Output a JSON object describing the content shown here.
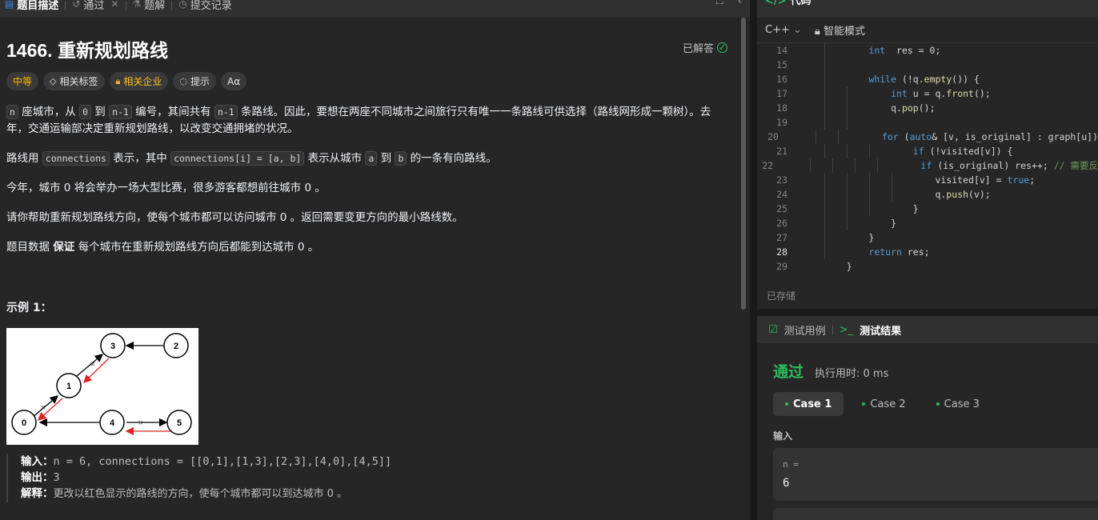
{
  "tabs": [
    {
      "label": "题目描述",
      "icon": "document-icon"
    },
    {
      "label": "通过",
      "icon": "history-icon"
    },
    {
      "label": "题解",
      "icon": "flask-icon"
    },
    {
      "label": "提交记录",
      "icon": "clock-icon"
    }
  ],
  "problem": {
    "title": "1466. 重新规划路线",
    "solved_label": "已解答",
    "tags": {
      "difficulty": "中等",
      "related_tags": "相关标签",
      "companies": "相关企业",
      "hint": "提示",
      "font": "Aα"
    },
    "desc": {
      "p1_code_n": "n",
      "p1_a": " 座城市，从 ",
      "p1_code_0": "0",
      "p1_b": " 到 ",
      "p1_code_n1": "n-1",
      "p1_c": " 编号，其间共有 ",
      "p1_code_n1b": "n-1",
      "p1_d": " 条路线。因此，要想在两座不同城市之间旅行只有唯一一条路线可供选择（路线网形成一颗树）。去年，交通运输部决定重新规划路线，以改变交通拥堵的状况。",
      "p2_a": "路线用 ",
      "p2_code1": "connections",
      "p2_b": " 表示，其中 ",
      "p2_code2": "connections[i] = [a, b]",
      "p2_c": " 表示从城市 ",
      "p2_code3": "a",
      "p2_d": " 到 ",
      "p2_code4": "b",
      "p2_e": " 的一条有向路线。",
      "p3": "今年，城市 0 将会举办一场大型比赛，很多游客都想前往城市 0 。",
      "p4": "请你帮助重新规划路线方向，使每个城市都可以访问城市 0 。返回需要变更方向的最小路线数。",
      "p5_a": "题目数据 ",
      "p5_bold": "保证",
      "p5_b": " 每个城市在重新规划路线方向后都能到达城市 0 。"
    },
    "example": {
      "title": "示例 1：",
      "graph_nodes": [
        "0",
        "1",
        "3",
        "2",
        "4",
        "5"
      ],
      "graph_mark": "×",
      "input_label": "输入：",
      "input_value": "n = 6, connections = [[0,1],[1,3],[2,3],[4,0],[4,5]]",
      "output_label": "输出：",
      "output_value": "3",
      "explain_label": "解释：",
      "explain_value": "更改以红色显示的路线的方向，使每个城市都可以到达城市 0 。"
    }
  },
  "editor": {
    "title": "代码",
    "language": "C++",
    "mode": "智能模式",
    "saved": "已存储",
    "lines": [
      {
        "n": "14",
        "indent": 1,
        "code": [
          [
            "kw",
            "int"
          ],
          [
            "",
            "  res = 0;"
          ]
        ]
      },
      {
        "n": "15",
        "indent": 1,
        "code": []
      },
      {
        "n": "16",
        "indent": 1,
        "code": [
          [
            "kw",
            "while"
          ],
          [
            "",
            " (!q."
          ],
          [
            "fn",
            "empty"
          ],
          [
            "",
            "()) {"
          ]
        ]
      },
      {
        "n": "17",
        "indent": 2,
        "code": [
          [
            "kw",
            "int"
          ],
          [
            "",
            " u = q."
          ],
          [
            "fn",
            "front"
          ],
          [
            "",
            "();"
          ]
        ]
      },
      {
        "n": "18",
        "indent": 2,
        "code": [
          [
            "",
            "q."
          ],
          [
            "fn",
            "pop"
          ],
          [
            "",
            "();"
          ]
        ]
      },
      {
        "n": "19",
        "indent": 2,
        "code": []
      },
      {
        "n": "20",
        "indent": 2,
        "code": [
          [
            "kw",
            "for"
          ],
          [
            "",
            " ("
          ],
          [
            "kw",
            "auto"
          ],
          [
            "",
            "& [v, is_original] : graph[u])"
          ]
        ]
      },
      {
        "n": "21",
        "indent": 3,
        "code": [
          [
            "kw",
            "if"
          ],
          [
            "",
            " (!visited[v]) {"
          ]
        ]
      },
      {
        "n": "22",
        "indent": 4,
        "code": [
          [
            "kw",
            "if"
          ],
          [
            "",
            " (is_original) res++; "
          ],
          [
            "cm",
            "// 需要反"
          ]
        ]
      },
      {
        "n": "23",
        "indent": 4,
        "code": [
          [
            "",
            "visited[v] = "
          ],
          [
            "kw",
            "true"
          ],
          [
            "",
            ";"
          ]
        ]
      },
      {
        "n": "24",
        "indent": 4,
        "code": [
          [
            "",
            "q."
          ],
          [
            "fn",
            "push"
          ],
          [
            "",
            "(v);"
          ]
        ]
      },
      {
        "n": "25",
        "indent": 3,
        "code": [
          [
            "",
            "}"
          ]
        ]
      },
      {
        "n": "26",
        "indent": 2,
        "code": [
          [
            "",
            "}"
          ]
        ]
      },
      {
        "n": "27",
        "indent": 1,
        "code": [
          [
            "",
            "}"
          ]
        ]
      },
      {
        "n": "28",
        "indent": 1,
        "code": [
          [
            "kw",
            "return"
          ],
          [
            "",
            " res;"
          ]
        ]
      },
      {
        "n": "29",
        "indent": 0,
        "code": [
          [
            "",
            "}"
          ]
        ]
      }
    ],
    "current_line": "28"
  },
  "testpanel": {
    "tab_cases": "测试用例",
    "tab_results": "测试结果",
    "status": "通过",
    "runtime": "执行用时: 0 ms",
    "cases": [
      "Case 1",
      "Case 2",
      "Case 3"
    ],
    "input_label": "输入",
    "input_name": "n =",
    "input_value": "6"
  }
}
